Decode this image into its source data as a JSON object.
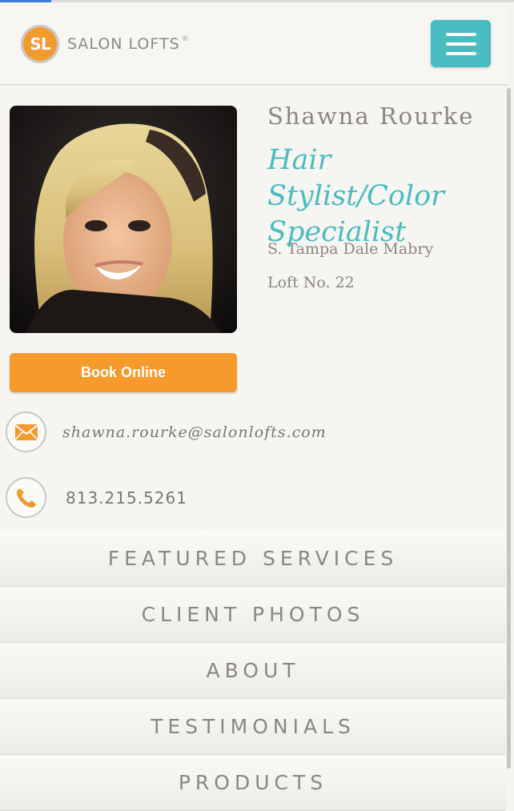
{
  "header": {
    "logo_badge": "SL",
    "logo_text": "SALON LOFTS",
    "logo_reg": "®",
    "menu_icon": "hamburger-menu-icon",
    "accent_color": "#49bcc1"
  },
  "profile": {
    "name": "Shawna Rourke",
    "role": "Hair Stylist/Color Specialist",
    "location_line1": "S. Tampa Dale Mabry",
    "location_line2": "Loft No. 22",
    "photo_alt": "stylist-portrait"
  },
  "book_button": {
    "label": "Book Online",
    "color": "#f79a2e"
  },
  "contact": {
    "email": "shawna.rourke@salonlofts.com",
    "email_icon": "envelope-icon",
    "phone": "813.215.5261",
    "phone_icon": "phone-icon"
  },
  "nav": {
    "items": [
      {
        "label": "FEATURED SERVICES"
      },
      {
        "label": "CLIENT PHOTOS"
      },
      {
        "label": "ABOUT"
      },
      {
        "label": "TESTIMONIALS"
      },
      {
        "label": "PRODUCTS"
      }
    ]
  }
}
